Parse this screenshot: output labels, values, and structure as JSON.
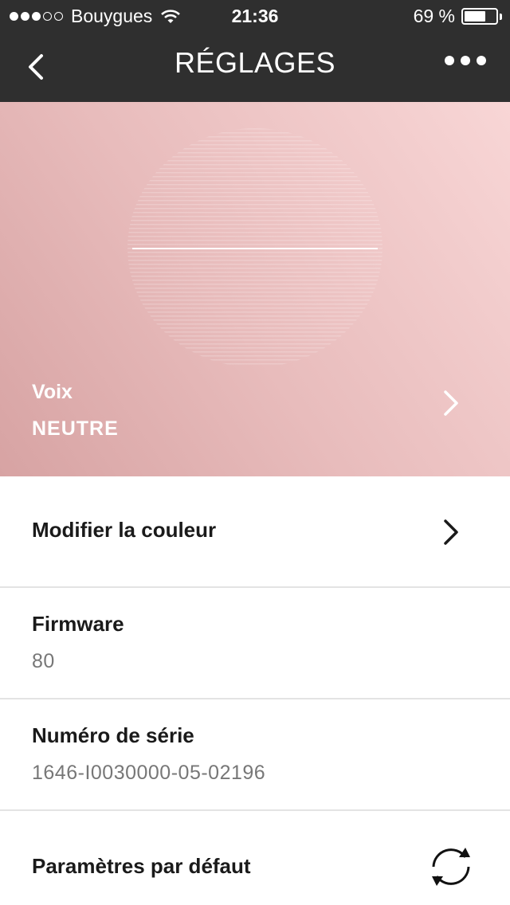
{
  "status_bar": {
    "carrier": "Bouygues",
    "signal_bars_filled": 3,
    "signal_bars_total": 5,
    "time": "21:36",
    "battery_percent": "69 %",
    "battery_level": 0.69,
    "icons": [
      "wifi-icon",
      "battery-icon"
    ]
  },
  "nav": {
    "title": "RÉGLAGES",
    "back_icon": "chevron-left-icon",
    "more_icon": "more-icon"
  },
  "hero": {
    "label": "Voix",
    "value": "NEUTRE",
    "chevron_icon": "chevron-right-icon",
    "colors": {
      "start": "#d7a3a3",
      "end": "#f8d6d6"
    }
  },
  "settings": {
    "color": {
      "title": "Modifier la couleur"
    },
    "firmware": {
      "title": "Firmware",
      "value": "80"
    },
    "serial": {
      "title": "Numéro de série",
      "value": "1646-I0030000-05-02196"
    },
    "defaults": {
      "title": "Paramètres par défaut",
      "icon": "refresh-icon"
    }
  }
}
